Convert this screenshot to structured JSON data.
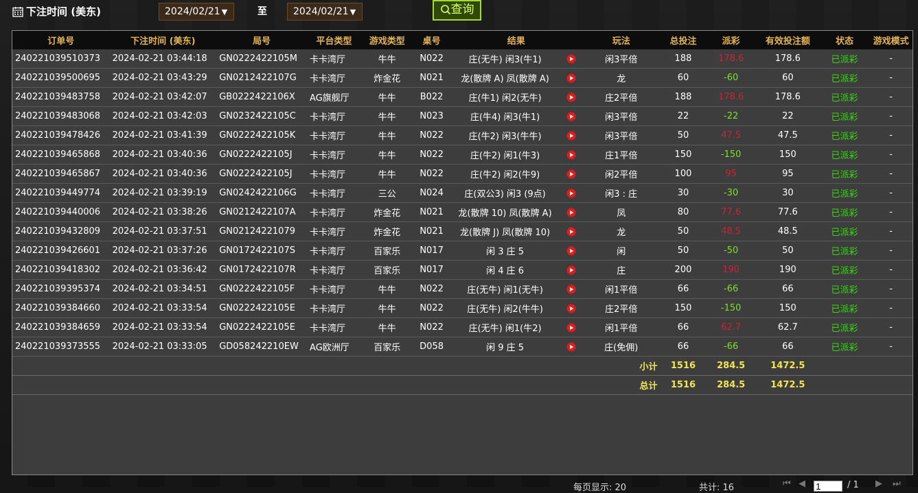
{
  "header": {
    "title": "下注时间 (美东)",
    "start_date": "2024/02/21",
    "end_date": "2024/02/21",
    "to_label": "至",
    "query_label": "查询",
    "dropdown_arrow": "▼"
  },
  "table": {
    "columns": [
      "订单号",
      "下注时间 (美东)",
      "局号",
      "平台类型",
      "游戏类型",
      "桌号",
      "结果",
      "玩法",
      "总投注",
      "派彩",
      "有效投注额",
      "状态",
      "游戏模式"
    ],
    "rows": [
      {
        "order": "240221039510373",
        "time": "2024-02-21 03:44:18",
        "round": "GN0222422105M",
        "platform": "卡卡湾厅",
        "game": "牛牛",
        "table": "N022",
        "result": "庄(无牛) 闲3(牛1)",
        "play": "闲3平倍",
        "bet": "188",
        "payout": "178.6",
        "payout_type": "win",
        "valid": "178.6",
        "status": "已派彩",
        "mode": "-"
      },
      {
        "order": "240221039500695",
        "time": "2024-02-21 03:43:29",
        "round": "GN0212422107G",
        "platform": "卡卡湾厅",
        "game": "炸金花",
        "table": "N021",
        "result": "龙(散牌 A) 凤(散牌 A)",
        "play": "龙",
        "bet": "60",
        "payout": "-60",
        "payout_type": "lose",
        "valid": "60",
        "status": "已派彩",
        "mode": "-"
      },
      {
        "order": "240221039483758",
        "time": "2024-02-21 03:42:07",
        "round": "GB0222422106X",
        "platform": "AG旗舰厅",
        "game": "牛牛",
        "table": "B022",
        "result": "庄(牛1) 闲2(无牛)",
        "play": "庄2平倍",
        "bet": "188",
        "payout": "178.6",
        "payout_type": "win",
        "valid": "178.6",
        "status": "已派彩",
        "mode": "-"
      },
      {
        "order": "240221039483068",
        "time": "2024-02-21 03:42:03",
        "round": "GN0232422105C",
        "platform": "卡卡湾厅",
        "game": "牛牛",
        "table": "N023",
        "result": "庄(牛4) 闲3(牛1)",
        "play": "闲3平倍",
        "bet": "22",
        "payout": "-22",
        "payout_type": "lose",
        "valid": "22",
        "status": "已派彩",
        "mode": "-"
      },
      {
        "order": "240221039478426",
        "time": "2024-02-21 03:41:39",
        "round": "GN0222422105K",
        "platform": "卡卡湾厅",
        "game": "牛牛",
        "table": "N022",
        "result": "庄(牛2) 闲3(牛牛)",
        "play": "闲3平倍",
        "bet": "50",
        "payout": "47.5",
        "payout_type": "win",
        "valid": "47.5",
        "status": "已派彩",
        "mode": "-"
      },
      {
        "order": "240221039465868",
        "time": "2024-02-21 03:40:36",
        "round": "GN0222422105J",
        "platform": "卡卡湾厅",
        "game": "牛牛",
        "table": "N022",
        "result": "庄(牛2) 闲1(牛3)",
        "play": "庄1平倍",
        "bet": "150",
        "payout": "-150",
        "payout_type": "lose",
        "valid": "150",
        "status": "已派彩",
        "mode": "-"
      },
      {
        "order": "240221039465867",
        "time": "2024-02-21 03:40:36",
        "round": "GN0222422105J",
        "platform": "卡卡湾厅",
        "game": "牛牛",
        "table": "N022",
        "result": "庄(牛2) 闲2(牛9)",
        "play": "闲2平倍",
        "bet": "100",
        "payout": "95",
        "payout_type": "win",
        "valid": "95",
        "status": "已派彩",
        "mode": "-"
      },
      {
        "order": "240221039449774",
        "time": "2024-02-21 03:39:19",
        "round": "GN0242422106G",
        "platform": "卡卡湾厅",
        "game": "三公",
        "table": "N024",
        "result": "庄(双公3) 闲3 (9点)",
        "play": "闲3 : 庄",
        "bet": "30",
        "payout": "-30",
        "payout_type": "lose",
        "valid": "30",
        "status": "已派彩",
        "mode": "-"
      },
      {
        "order": "240221039440006",
        "time": "2024-02-21 03:38:26",
        "round": "GN0212422107A",
        "platform": "卡卡湾厅",
        "game": "炸金花",
        "table": "N021",
        "result": "龙(散牌 10) 凤(散牌 A)",
        "play": "凤",
        "bet": "80",
        "payout": "77.6",
        "payout_type": "win",
        "valid": "77.6",
        "status": "已派彩",
        "mode": "-"
      },
      {
        "order": "240221039432809",
        "time": "2024-02-21 03:37:51",
        "round": "GN02124221079",
        "platform": "卡卡湾厅",
        "game": "炸金花",
        "table": "N021",
        "result": "龙(散牌 J) 凤(散牌 10)",
        "play": "龙",
        "bet": "50",
        "payout": "48.5",
        "payout_type": "win",
        "valid": "48.5",
        "status": "已派彩",
        "mode": "-"
      },
      {
        "order": "240221039426601",
        "time": "2024-02-21 03:37:26",
        "round": "GN0172422107S",
        "platform": "卡卡湾厅",
        "game": "百家乐",
        "table": "N017",
        "result": "闲 3 庄 5",
        "play": "闲",
        "bet": "50",
        "payout": "-50",
        "payout_type": "lose",
        "valid": "50",
        "status": "已派彩",
        "mode": "-"
      },
      {
        "order": "240221039418302",
        "time": "2024-02-21 03:36:42",
        "round": "GN0172422107R",
        "platform": "卡卡湾厅",
        "game": "百家乐",
        "table": "N017",
        "result": "闲 4 庄 6",
        "play": "庄",
        "bet": "200",
        "payout": "190",
        "payout_type": "win",
        "valid": "190",
        "status": "已派彩",
        "mode": "-"
      },
      {
        "order": "240221039395374",
        "time": "2024-02-21 03:34:51",
        "round": "GN0222422105F",
        "platform": "卡卡湾厅",
        "game": "牛牛",
        "table": "N022",
        "result": "庄(无牛) 闲1(无牛)",
        "play": "闲1平倍",
        "bet": "66",
        "payout": "-66",
        "payout_type": "lose",
        "valid": "66",
        "status": "已派彩",
        "mode": "-"
      },
      {
        "order": "240221039384660",
        "time": "2024-02-21 03:33:54",
        "round": "GN0222422105E",
        "platform": "卡卡湾厅",
        "game": "牛牛",
        "table": "N022",
        "result": "庄(无牛) 闲2(牛牛)",
        "play": "庄2平倍",
        "bet": "150",
        "payout": "-150",
        "payout_type": "lose",
        "valid": "150",
        "status": "已派彩",
        "mode": "-"
      },
      {
        "order": "240221039384659",
        "time": "2024-02-21 03:33:54",
        "round": "GN0222422105E",
        "platform": "卡卡湾厅",
        "game": "牛牛",
        "table": "N022",
        "result": "庄(无牛) 闲1(牛2)",
        "play": "闲1平倍",
        "bet": "66",
        "payout": "62.7",
        "payout_type": "win",
        "valid": "62.7",
        "status": "已派彩",
        "mode": "-"
      },
      {
        "order": "240221039373555",
        "time": "2024-02-21 03:33:05",
        "round": "GD058242210EW",
        "platform": "AG欧洲厅",
        "game": "百家乐",
        "table": "D058",
        "result": "闲 9 庄 5",
        "play": "庄(免佣)",
        "bet": "66",
        "payout": "-66",
        "payout_type": "lose",
        "valid": "66",
        "status": "已派彩",
        "mode": "-"
      }
    ],
    "subtotal": {
      "label": "小计",
      "bet": "1516",
      "payout": "284.5",
      "valid": "1472.5"
    },
    "total": {
      "label": "总计",
      "bet": "1516",
      "payout": "284.5",
      "valid": "1472.5"
    }
  },
  "pager": {
    "per_page": "每页显示: 20",
    "total": "共计: 16",
    "current_page": "1",
    "page_count": "/ 1"
  },
  "colors": {
    "header_text": "#e2b35a",
    "payout_win": "#c3263a",
    "payout_lose": "#7ee02c",
    "status_paid": "#3dd317",
    "summary_text": "#f2e54f"
  }
}
